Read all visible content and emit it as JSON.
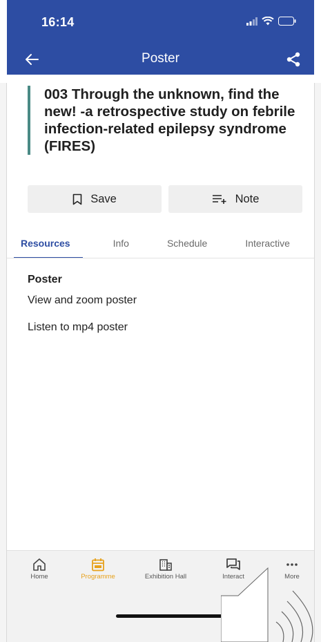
{
  "status_bar": {
    "time": "16:14"
  },
  "app_bar": {
    "title": "Poster"
  },
  "poster": {
    "title": "003 Through the unknown, find the new!  -a retrospective study on febrile infection-related epilepsy syndrome (FIRES)"
  },
  "actions": {
    "save_label": "Save",
    "note_label": "Note"
  },
  "tabs": [
    {
      "label": "Resources",
      "active": true
    },
    {
      "label": "Info",
      "active": false
    },
    {
      "label": "Schedule",
      "active": false
    },
    {
      "label": "Interactive",
      "active": false
    }
  ],
  "content": {
    "section_title": "Poster",
    "links": [
      "View and zoom poster",
      "Listen to mp4 poster"
    ]
  },
  "bottom_nav": [
    {
      "label": "Home",
      "icon": "home-icon",
      "active": false
    },
    {
      "label": "Programme",
      "icon": "calendar-icon",
      "active": true
    },
    {
      "label": "Exhibition Hall",
      "icon": "building-icon",
      "active": false
    },
    {
      "label": "Interact",
      "icon": "chat-icon",
      "active": false
    },
    {
      "label": "More",
      "icon": "more-icon",
      "active": false
    }
  ],
  "colors": {
    "primary": "#2d4da3",
    "accent_bar": "#4a8a85",
    "active_nav": "#e7a11c"
  }
}
